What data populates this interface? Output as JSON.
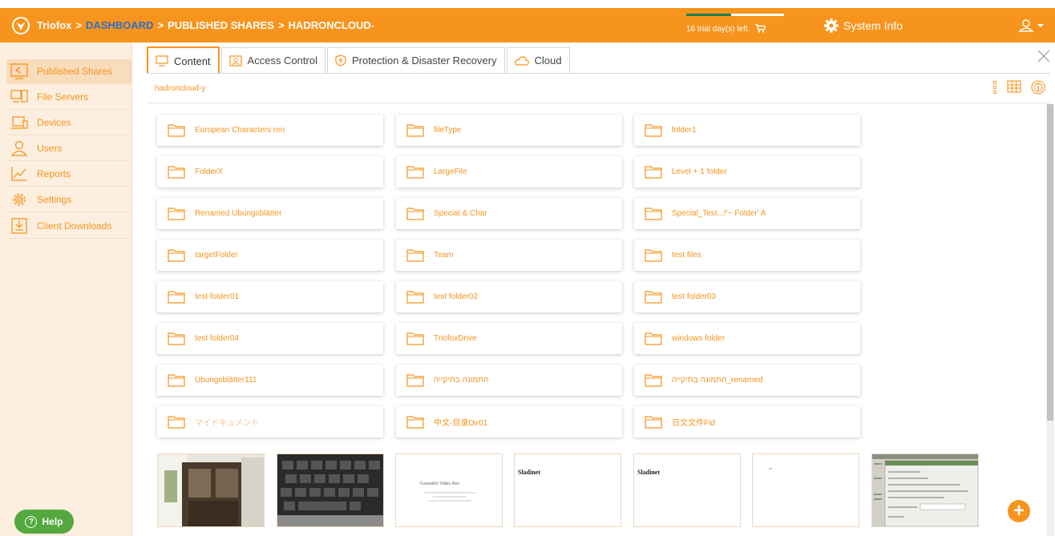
{
  "header": {
    "brand": "Triofox",
    "breadcrumb": [
      "DASHBOARD",
      "PUBLISHED SHARES",
      "HADRONCLOUD-"
    ],
    "separator": ">",
    "trial_text": "16 trial day(s) left.",
    "trial_progress": 0.46,
    "system_info": "System Info"
  },
  "sidebar": {
    "items": [
      {
        "label": "Published Shares",
        "icon": "published-shares-icon",
        "active": true
      },
      {
        "label": "File Servers",
        "icon": "file-servers-icon",
        "active": false
      },
      {
        "label": "Devices",
        "icon": "devices-icon",
        "active": false
      },
      {
        "label": "Users",
        "icon": "users-icon",
        "active": false
      },
      {
        "label": "Reports",
        "icon": "reports-icon",
        "active": false
      },
      {
        "label": "Settings",
        "icon": "settings-icon",
        "active": false
      },
      {
        "label": "Client Downloads",
        "icon": "client-downloads-icon",
        "active": false
      }
    ],
    "help_label": "Help"
  },
  "tabs": [
    {
      "label": "Content",
      "active": true
    },
    {
      "label": "Access Control",
      "active": false
    },
    {
      "label": "Protection & Disaster Recovery",
      "active": false
    },
    {
      "label": "Cloud",
      "active": false
    }
  ],
  "path": "hadroncloud-y",
  "folders": [
    "European Characters ren",
    "fileType",
    "folder1",
    "FolderX",
    "LargeFile",
    "Level + 1 folder",
    "Renamed Übungsblätter",
    "Special & Char",
    "Special_Test...!'~ Folder' A",
    "targetFolder",
    " Team",
    "test files",
    "test folder01",
    "test folder02",
    "test folder03",
    "test folder04",
    "TriofoxDrive",
    "windows folder",
    "Übungsblätter111",
    "התמונה בתיקייה",
    "התמונה בתיקייה_renamed",
    "マイドキュメント",
    "中文-目录Dir01",
    "日文文件Fld"
  ],
  "thumbnails": [
    {
      "kind": "photo-room"
    },
    {
      "kind": "photo-keyboard"
    },
    {
      "kind": "doc-centered",
      "text": "Gravador Video Rec"
    },
    {
      "kind": "doc-heading",
      "text": "Sladinet"
    },
    {
      "kind": "doc-heading",
      "text": "Sladinet"
    },
    {
      "kind": "doc-blank"
    },
    {
      "kind": "screenshot-dialog"
    }
  ],
  "colors": {
    "accent": "#f7941d",
    "help": "#54a93e",
    "link": "#2d6fc4"
  }
}
